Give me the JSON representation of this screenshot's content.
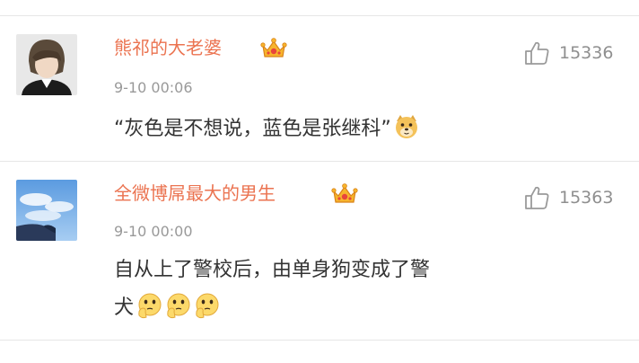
{
  "comments": [
    {
      "username": "熊祁的大老婆",
      "badge_icon": "crown-badge-icon",
      "timestamp": "9-10 00:06",
      "likes": "15336",
      "text": "“灰色是不想说，蓝色是张继科”",
      "emojis": [
        "doge-emoji"
      ]
    },
    {
      "username": "全微博屌最大的男生",
      "badge_icon": "crown-badge-icon",
      "timestamp": "9-10 00:00",
      "likes": "15363",
      "text_line1": "自从上了警校后，由单身狗变成了警",
      "text_line2": "犬",
      "emojis": [
        "thinking-emoji",
        "thinking-emoji",
        "thinking-emoji"
      ]
    }
  ],
  "colors": {
    "username": "#eb7350",
    "meta": "#999999",
    "text": "#333333"
  }
}
